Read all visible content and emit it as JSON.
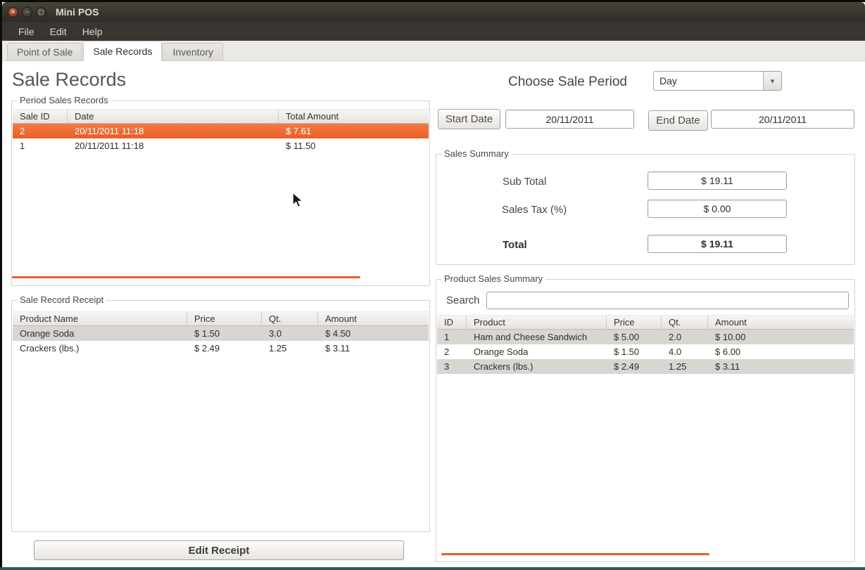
{
  "window": {
    "title": "Mini POS",
    "menus": [
      "File",
      "Edit",
      "Help"
    ]
  },
  "icons": {
    "close": "✕",
    "minimize": "−",
    "maximize": "▢",
    "dropdown": "▾"
  },
  "tabs": [
    {
      "label": "Point of Sale",
      "active": false
    },
    {
      "label": "Sale Records",
      "active": true
    },
    {
      "label": "Inventory",
      "active": false
    }
  ],
  "page": {
    "title": "Sale Records"
  },
  "period_sales": {
    "label": "Period Sales Records",
    "columns": [
      "Sale ID",
      "Date",
      "Total Amount"
    ],
    "rows": [
      {
        "id": "2",
        "date": "20/11/2011 11:18",
        "amount": "$ 7.61",
        "selected": true
      },
      {
        "id": "1",
        "date": "20/11/2011 11:18",
        "amount": "$ 11.50",
        "selected": false
      }
    ]
  },
  "receipt": {
    "label": "Sale Record Receipt",
    "columns": [
      "Product Name",
      "Price",
      "Qt.",
      "Amount"
    ],
    "rows": [
      {
        "product": "Orange Soda",
        "price": "$ 1.50",
        "qty": "3.0",
        "amount": "$ 4.50"
      },
      {
        "product": "Crackers (lbs.)",
        "price": "$ 2.49",
        "qty": "1.25",
        "amount": "$ 3.11"
      }
    ],
    "edit_button": "Edit Receipt"
  },
  "period_selector": {
    "label": "Choose Sale Period",
    "value": "Day"
  },
  "date_range": {
    "start_label": "Start Date",
    "start_value": "20/11/2011",
    "end_label": "End Date",
    "end_value": "20/11/2011"
  },
  "sales_summary": {
    "label": "Sales Summary",
    "sub_total_label": "Sub Total",
    "sub_total_value": "$ 19.11",
    "sales_tax_label": "Sales Tax (%)",
    "sales_tax_value": "$ 0.00",
    "total_label": "Total",
    "total_value": "$ 19.11"
  },
  "product_summary": {
    "label": "Product Sales Summary",
    "search_label": "Search",
    "search_value": "",
    "columns": [
      "ID",
      "Product",
      "Price",
      "Qt.",
      "Amount"
    ],
    "rows": [
      {
        "id": "1",
        "product": "Ham and Cheese Sandwich",
        "price": "$ 5.00",
        "qty": "2.0",
        "amount": "$ 10.00"
      },
      {
        "id": "2",
        "product": "Orange Soda",
        "price": "$ 1.50",
        "qty": "4.0",
        "amount": "$ 6.00"
      },
      {
        "id": "3",
        "product": "Crackers (lbs.)",
        "price": "$ 2.49",
        "qty": "1.25",
        "amount": "$ 3.11"
      }
    ]
  }
}
